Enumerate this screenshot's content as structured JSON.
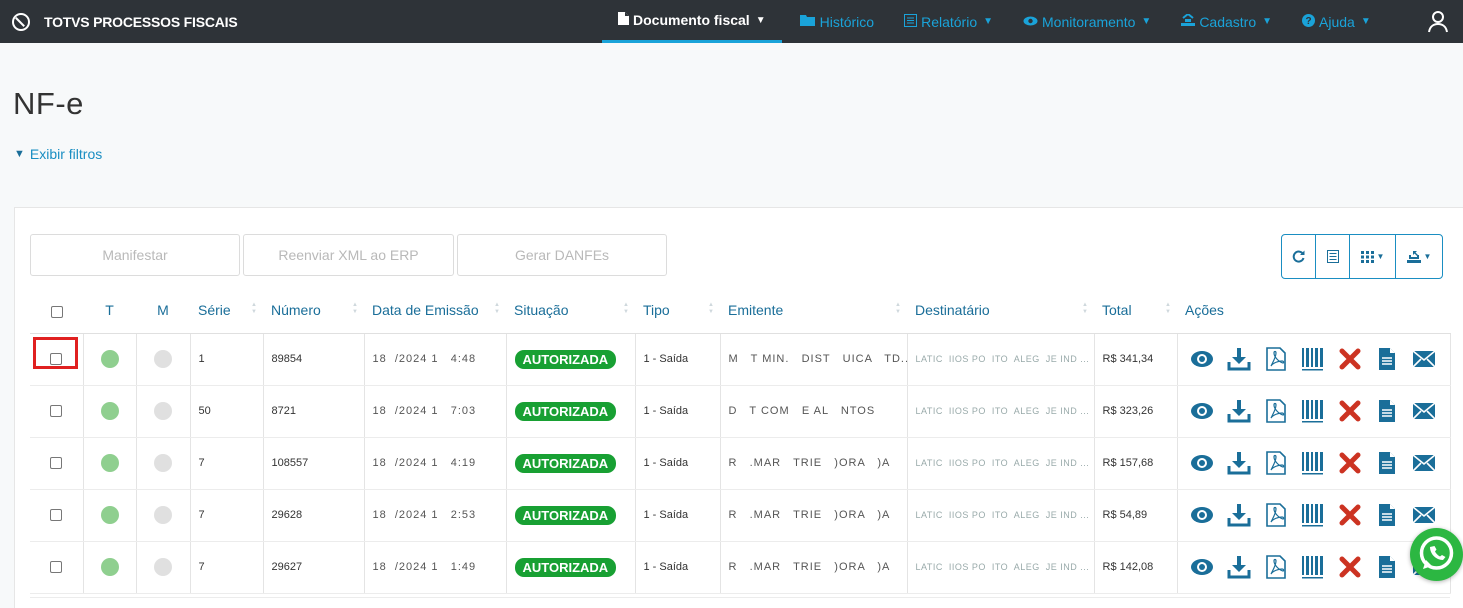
{
  "brand": {
    "name": "TOTVS PROCESSOS FISCAIS"
  },
  "nav": {
    "items": [
      {
        "label": "Documento fiscal",
        "icon": "document-icon",
        "active": true,
        "dropdown": true
      },
      {
        "label": "Histórico",
        "icon": "folder-icon",
        "active": false,
        "dropdown": false
      },
      {
        "label": "Relatório",
        "icon": "report-icon",
        "active": false,
        "dropdown": true
      },
      {
        "label": "Monitoramento",
        "icon": "eye-icon",
        "active": false,
        "dropdown": true
      },
      {
        "label": "Cadastro",
        "icon": "register-icon",
        "active": false,
        "dropdown": true
      },
      {
        "label": "Ajuda",
        "icon": "help-icon",
        "active": false,
        "dropdown": true
      }
    ]
  },
  "page": {
    "title": "NF-e",
    "filters_label": "Exibir filtros"
  },
  "toolbar": {
    "buttons": [
      "Manifestar",
      "Reenviar XML ao ERP",
      "Gerar DANFEs"
    ],
    "tools": [
      "refresh-icon",
      "list-icon",
      "columns-icon",
      "export-icon"
    ]
  },
  "table": {
    "headers": [
      "T",
      "M",
      "Série",
      "Número",
      "Data de Emissão",
      "Situação",
      "Tipo",
      "Emitente",
      "Destinatário",
      "Total",
      "Ações"
    ],
    "rows": [
      {
        "serie": "1",
        "numero": "89854",
        "data": "18  /2024 1   4:48",
        "situacao": "AUTORIZADA",
        "tipo": "1 - Saída",
        "emitente": "M   T MIN.   DIST   UICA   TD...",
        "destinatario": "LATIC  IIOS PO  ITO  ALEG  JE IND ...",
        "total": "R$ 341,34"
      },
      {
        "serie": "50",
        "numero": "8721",
        "data": "18  /2024 1   7:03",
        "situacao": "AUTORIZADA",
        "tipo": "1 - Saída",
        "emitente": "D   T COM   E AL   NTOS",
        "destinatario": "LATIC  IIOS PO  ITO  ALEG  JE IND ...",
        "total": "R$ 323,26"
      },
      {
        "serie": "7",
        "numero": "108557",
        "data": "18  /2024 1   4:19",
        "situacao": "AUTORIZADA",
        "tipo": "1 - Saída",
        "emitente": "R   .MAR   TRIE   )ORA   )A",
        "destinatario": "LATIC  IIOS PO  ITO  ALEG  JE IND ...",
        "total": "R$ 157,68"
      },
      {
        "serie": "7",
        "numero": "29628",
        "data": "18  /2024 1   2:53",
        "situacao": "AUTORIZADA",
        "tipo": "1 - Saída",
        "emitente": "R   .MAR   TRIE   )ORA   )A",
        "destinatario": "LATIC  IIOS PO  ITO  ALEG  JE IND ...",
        "total": "R$ 54,89"
      },
      {
        "serie": "7",
        "numero": "29627",
        "data": "18  /2024 1   1:49",
        "situacao": "AUTORIZADA",
        "tipo": "1 - Saída",
        "emitente": "R   .MAR   TRIE   )ORA   )A",
        "destinatario": "LATIC  IIOS PO  ITO  ALEG  JE IND ...",
        "total": "R$ 142,08"
      }
    ],
    "action_icons": [
      "view-icon",
      "download-icon",
      "pdf-icon",
      "barcode-icon",
      "cancel-icon",
      "file-icon",
      "email-icon"
    ]
  },
  "colors": {
    "navbar": "#2e3338",
    "accent": "#1aa3d9",
    "link": "#1a6e99",
    "authorized": "#18a033",
    "status_green": "#8fcf8f",
    "status_gray": "#e0e0e0",
    "highlight": "#e02020"
  }
}
